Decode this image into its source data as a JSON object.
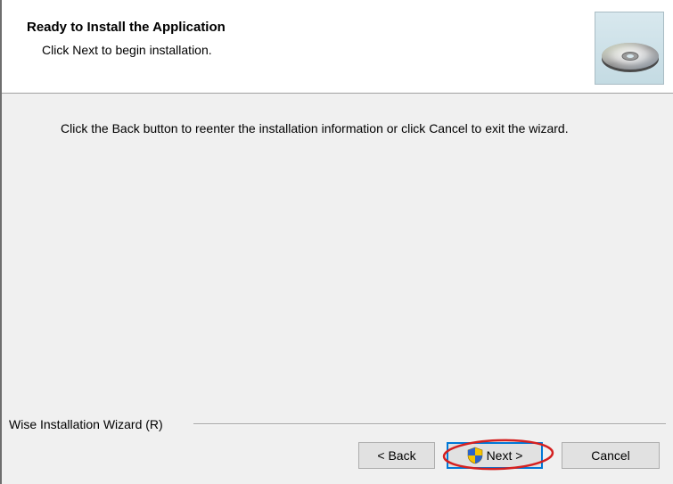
{
  "header": {
    "title": "Ready to Install the Application",
    "subtitle": "Click Next to begin installation.",
    "icon": "cd-disc-icon"
  },
  "body": {
    "instructions": "Click the Back button to reenter the installation information or click Cancel to exit the wizard."
  },
  "footer": {
    "brand_label": "Wise Installation Wizard (R)"
  },
  "buttons": {
    "back_label": "< Back",
    "next_label": "Next >",
    "cancel_label": "Cancel",
    "next_icon": "uac-shield-icon"
  },
  "colors": {
    "highlight": "#d42020",
    "focus_border": "#0078d7"
  }
}
